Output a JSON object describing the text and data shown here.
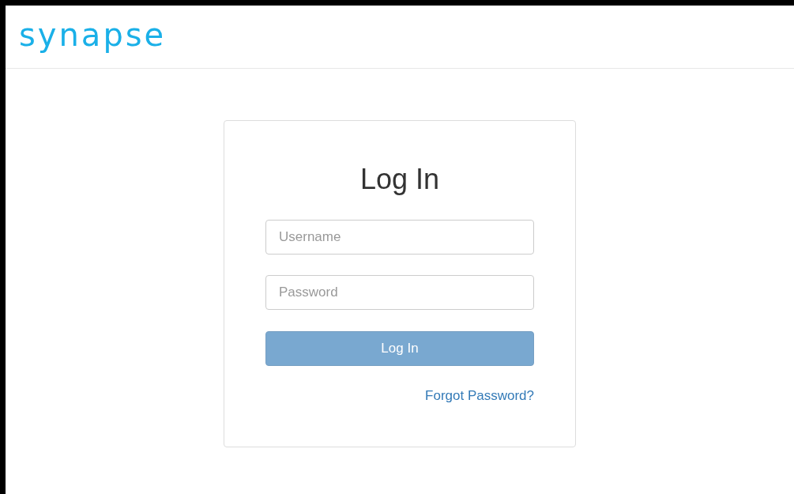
{
  "header": {
    "logo": "synapse"
  },
  "login": {
    "title": "Log In",
    "fields": [
      {
        "placeholder": "Username"
      },
      {
        "placeholder": "Password"
      }
    ],
    "submit": {
      "label": "Log In",
      "disabled": true
    },
    "forgot_link": "Forgot Password?"
  }
}
